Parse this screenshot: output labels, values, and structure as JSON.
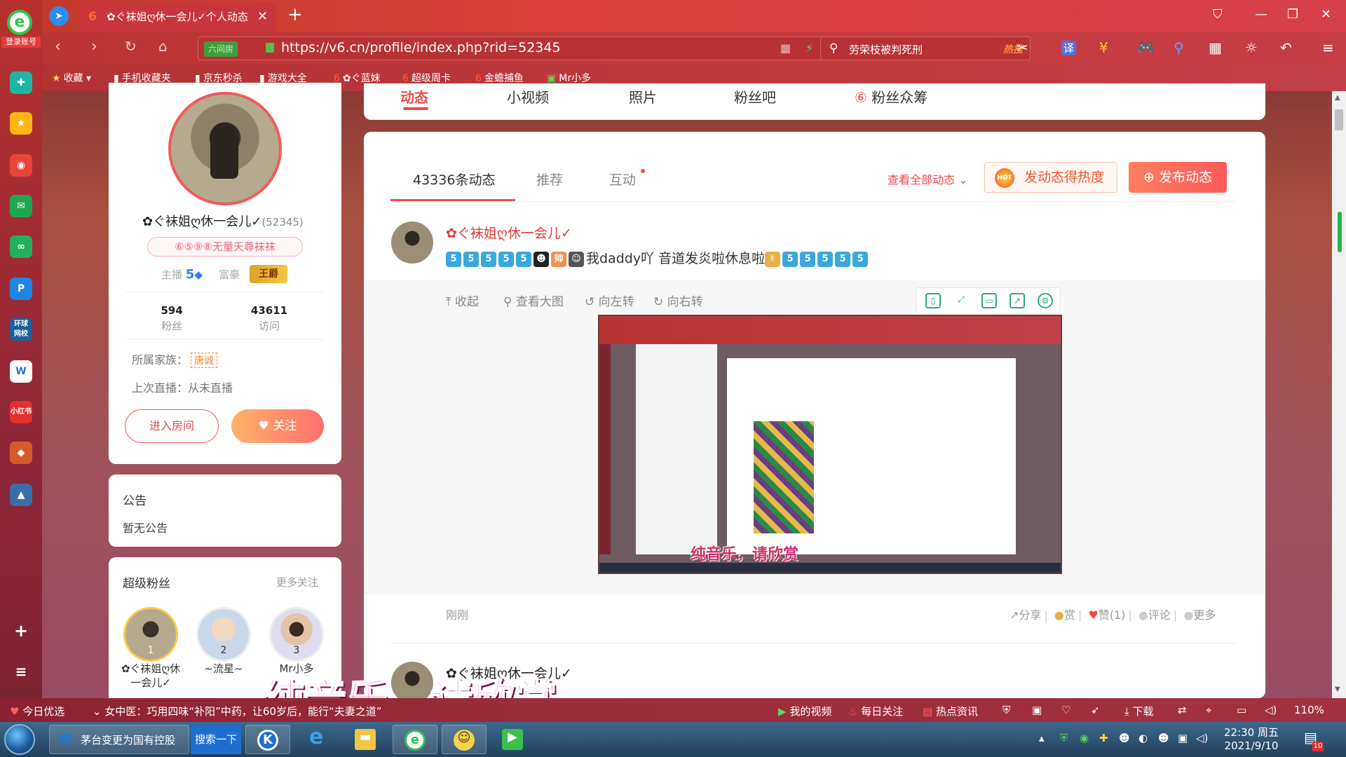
{
  "app": {
    "logo_label": "登录账号",
    "tab_title": "✿ぐ袜姐ღ休一会儿✓个人动态",
    "tab_favicon": "6"
  },
  "nav": {
    "cert_label": "六间房",
    "url": "https://v6.cn/profile/index.php?rid=52345",
    "search_query": "劳荣枝被判死刑",
    "search_hot": "热搜",
    "translate_label": "译"
  },
  "bookmarks": [
    {
      "label": "收藏",
      "icon": "star-icon"
    },
    {
      "label": "手机收藏夹",
      "icon": "folder-icon"
    },
    {
      "label": "京东秒杀",
      "icon": "doc-icon"
    },
    {
      "label": "游戏大全",
      "icon": "doc-icon"
    },
    {
      "label": "✿ぐ蓝妹",
      "icon": "v6-icon"
    },
    {
      "label": "超级周卡",
      "icon": "v6-icon"
    },
    {
      "label": "金蟾捕鱼",
      "icon": "v6-icon"
    },
    {
      "label": "Mr小多",
      "icon": "app-icon"
    }
  ],
  "profile": {
    "name": "✿ぐ袜姐ღ休一会儿✓",
    "rid": "(52345)",
    "level_badge": "⑥⑤⑨⑧无量天尊袜袜",
    "anchor_label": "主播",
    "anchor_level": "5",
    "rich_label": "富豪",
    "rich_title": "王爵",
    "fans_count": "594",
    "fans_label": "粉丝",
    "visits_count": "43611",
    "visits_label": "访问",
    "family_label": "所属家族：",
    "family_value": "唐诚",
    "last_live": "上次直播：从未直播",
    "enter_room": "进入房间",
    "follow": "关注"
  },
  "announcement": {
    "title": "公告",
    "content": "暂无公告"
  },
  "super_fans": {
    "title": "超级粉丝",
    "more": "更多关注",
    "items": [
      {
        "rank": "1",
        "name": "✿ぐ袜姐ღ休一会儿✓"
      },
      {
        "rank": "2",
        "name": "~流星~"
      },
      {
        "rank": "3",
        "name": "Mr小多"
      }
    ]
  },
  "top_tabs": [
    "动态",
    "小视频",
    "照片",
    "粉丝吧",
    "粉丝众筹"
  ],
  "sub_tabs": {
    "count": "43336条动态",
    "recommend": "推荐",
    "interact": "互动",
    "view_all": "查看全部动态",
    "hot_btn": "发动态得热度",
    "hot_icon_text": "HOT",
    "post_btn": "发布动态"
  },
  "post": {
    "author": "✿ぐ袜姐ღ休一会儿✓",
    "text": "我daddy吖 音道发炎啦休息啦",
    "image_tools": [
      "收起",
      "查看大图",
      "向左转",
      "向右转"
    ],
    "image_caption": "纯音乐，请欣赏",
    "time": "刚刚",
    "share": "分享",
    "reward": "赏",
    "like": "赞(1)",
    "comment": "评论",
    "more": "更多"
  },
  "next_post": {
    "author": "✿ぐ袜姐ღ休一会儿✓"
  },
  "overlay_caption": "纯音乐，请欣赏",
  "statusbar": {
    "today": "今日优选",
    "news": "女中医：巧用四味“补阳”中药，让60岁后，能行“夫妻之道”",
    "my_video": "我的视频",
    "daily_follow": "每日关注",
    "hot_news": "热点资讯",
    "download": "下载",
    "zoom": "110%"
  },
  "taskbar": {
    "ie_item": "茅台变更为国有控股",
    "search": "搜索一下",
    "time": "22:30 周五",
    "date": "2021/9/10",
    "notif_count": "10"
  }
}
